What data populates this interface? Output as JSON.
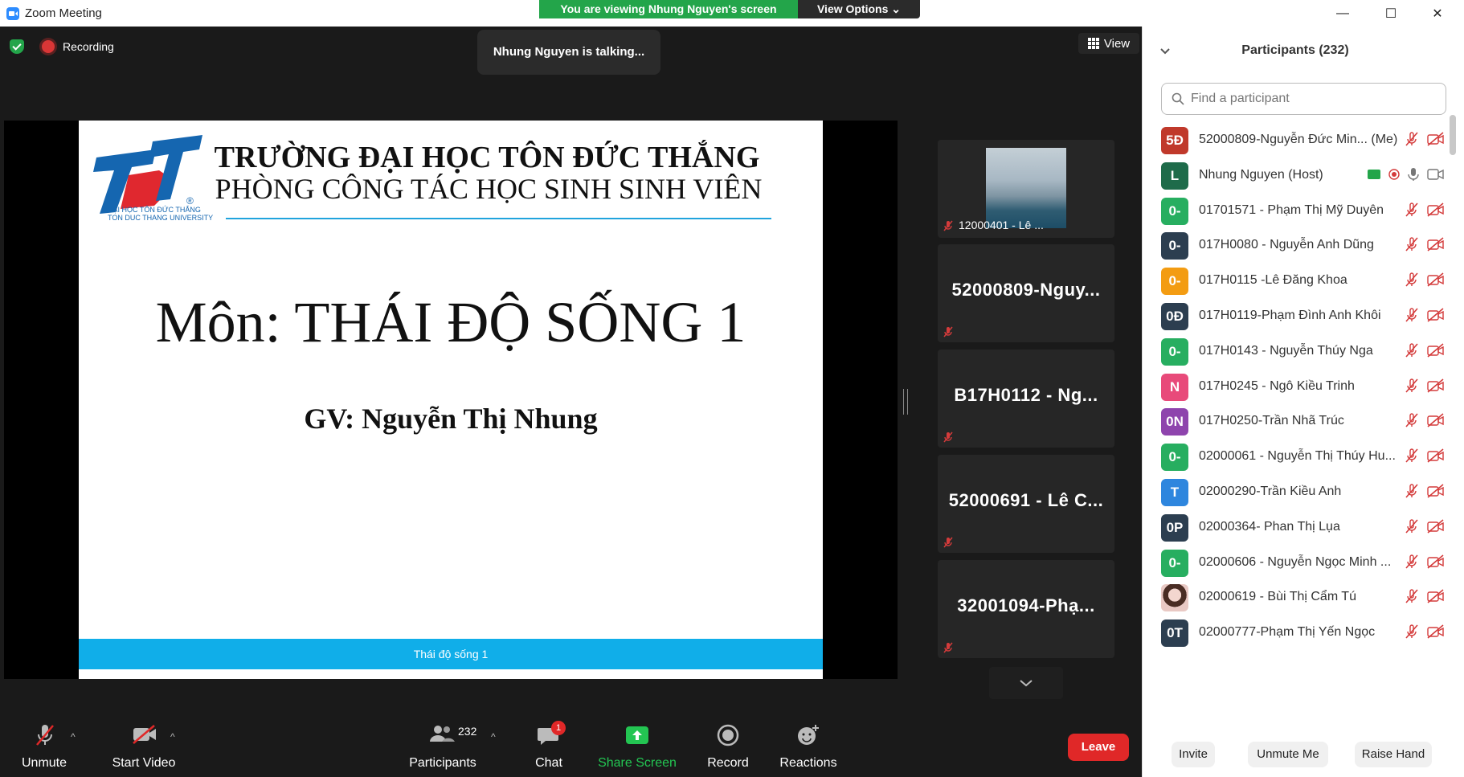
{
  "window": {
    "title": "Zoom Meeting",
    "minimize_glyph": "—",
    "maximize_glyph": "☐",
    "close_glyph": "✕"
  },
  "banner": {
    "text": "You are viewing Nhung Nguyen's screen",
    "view_options": "View Options ⌄"
  },
  "meeting": {
    "recording_label": "Recording",
    "talking": "Nhung Nguyen is talking...",
    "view_label": "View"
  },
  "slide": {
    "logo_lines": [
      "ĐẠI HỌC TÔN ĐỨC THẮNG",
      "TON DUC THANG UNIVERSITY"
    ],
    "logo_letters": "TDT",
    "heading1": "TRƯỜNG ĐẠI HỌC TÔN ĐỨC THẮNG",
    "heading2": "PHÒNG CÔNG TÁC HỌC SINH SINH VIÊN",
    "subject": "Môn: THÁI ĐỘ SỐNG 1",
    "teacher": "GV: Nguyễn Thị Nhung",
    "footer": "Thái độ sống 1"
  },
  "tiles": [
    {
      "label": "12000401 - Lê ..."
    },
    {
      "label": "52000809-Nguy..."
    },
    {
      "label": "B17H0112 - Ng..."
    },
    {
      "label": "52000691 - Lê C..."
    },
    {
      "label": "32001094-Phạ..."
    }
  ],
  "toolbar": {
    "unmute": "Unmute",
    "start_video": "Start Video",
    "participants": "Participants",
    "participants_count": "232",
    "chat": "Chat",
    "chat_badge": "1",
    "share_screen": "Share Screen",
    "record": "Record",
    "reactions": "Reactions",
    "leave": "Leave"
  },
  "panel": {
    "title": "Participants (232)",
    "search_placeholder": "Find a participant",
    "participants": [
      {
        "initials": "5Đ",
        "color": "#c0392b",
        "name": "52000809-Nguyễn Đức Min... (Me)"
      },
      {
        "initials": "L",
        "color": "#1e6b4a",
        "name": "Nhung Nguyen (Host)",
        "host": true
      },
      {
        "initials": "0-",
        "color": "#27ae60",
        "name": "01701571 - Phạm Thị Mỹ Duyên"
      },
      {
        "initials": "0-",
        "color": "#2c3e50",
        "name": "017H0080 - Nguyễn Anh Dũng"
      },
      {
        "initials": "0-",
        "color": "#f39c12",
        "name": "017H0115 -Lê Đăng Khoa"
      },
      {
        "initials": "0Đ",
        "color": "#2c3e50",
        "name": "017H0119-Phạm Đình Anh Khôi"
      },
      {
        "initials": "0-",
        "color": "#27ae60",
        "name": "017H0143 - Nguyễn Thúy Nga"
      },
      {
        "initials": "N",
        "color": "#e84a7a",
        "name": "017H0245 - Ngô Kiều Trinh"
      },
      {
        "initials": "0N",
        "color": "#8e44ad",
        "name": "017H0250-Trần Nhã Trúc"
      },
      {
        "initials": "0-",
        "color": "#27ae60",
        "name": "02000061 - Nguyễn Thị Thúy Hu..."
      },
      {
        "initials": "T",
        "color": "#2e86de",
        "name": "02000290-Trần Kiều Anh"
      },
      {
        "initials": "0P",
        "color": "#2c3e50",
        "name": "02000364- Phan Thị Lụa"
      },
      {
        "initials": "0-",
        "color": "#27ae60",
        "name": "02000606 - Nguyễn Ngọc Minh ..."
      },
      {
        "initials": "",
        "color": "#e9c9c4",
        "name": "02000619 - Bùi Thị Cẩm Tú",
        "photo": true
      },
      {
        "initials": "0T",
        "color": "#2c3e50",
        "name": "02000777-Phạm Thị Yến Ngọc"
      }
    ],
    "invite": "Invite",
    "unmute_me": "Unmute Me",
    "raise_hand": "Raise Hand"
  }
}
